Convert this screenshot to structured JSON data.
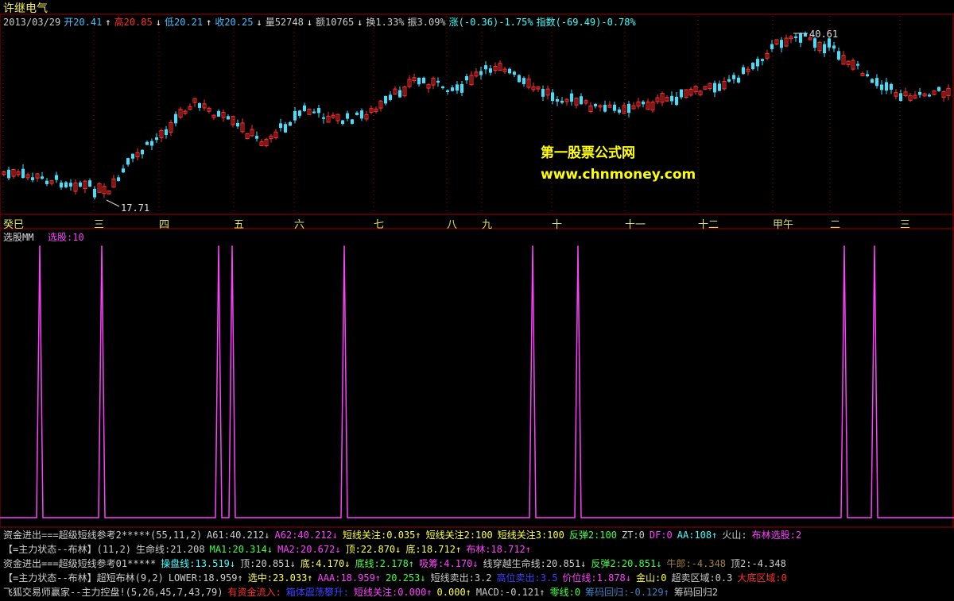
{
  "header": {
    "stock_name": "许继电气",
    "quote": [
      {
        "text": "2013/03/29",
        "color": "#cccccc"
      },
      {
        "text": "开20.41",
        "color": "#40c0ff"
      },
      {
        "text": "↑",
        "color": "#ffffff"
      },
      {
        "text": "高20.85",
        "color": "#ff3030"
      },
      {
        "text": "↓",
        "color": "#ffffff"
      },
      {
        "text": "低20.21",
        "color": "#40c0ff"
      },
      {
        "text": "↑",
        "color": "#ffffff"
      },
      {
        "text": "收20.25",
        "color": "#40c0ff"
      },
      {
        "text": "↓",
        "color": "#ffffff"
      },
      {
        "text": "量52748",
        "color": "#cccccc"
      },
      {
        "text": "↓",
        "color": "#ffffff"
      },
      {
        "text": "额10765",
        "color": "#cccccc"
      },
      {
        "text": "↓",
        "color": "#ffffff"
      },
      {
        "text": "换1.33%",
        "color": "#cccccc"
      },
      {
        "text": "振3.09%",
        "color": "#cccccc"
      },
      {
        "text": "涨(-0.36)-1.75%",
        "color": "#40ffff"
      },
      {
        "text": "指数(-69.49)-0.78%",
        "color": "#40ffff"
      }
    ]
  },
  "price_chart": {
    "high_label": "40.61",
    "low_label": "17.71",
    "watermark_title": "第一股票公式网",
    "watermark_url": "www.chnmoney.com",
    "months": [
      "癸巳",
      "三",
      "四",
      "五",
      "六",
      "七",
      "八",
      "九",
      "十",
      "十一",
      "十二",
      "甲午",
      "二",
      "三"
    ],
    "colors": {
      "up": "#ff3030",
      "down": "#40e0ff",
      "grid": "#a00000",
      "month": "#e0e060"
    }
  },
  "indicator": {
    "name": "选股MM",
    "value_label": "选股:10",
    "line_color": "#ff40ff"
  },
  "chart_data": {
    "type": "line",
    "title": "",
    "series": [
      {
        "name": "选股",
        "x": [
          50,
          128,
          275,
          292,
          433,
          670,
          727,
          1062,
          1100
        ],
        "values": [
          10,
          10,
          10,
          10,
          10,
          10,
          10,
          10,
          10
        ]
      }
    ],
    "ylim": [
      0,
      10
    ],
    "xlabel": "",
    "ylabel": ""
  },
  "bottom_lines": [
    [
      {
        "text": "资金进出===超级短线参考2*****(55,11,2)",
        "color": "#cccccc"
      },
      {
        "text": "A61:40.212↓",
        "color": "#cccccc"
      },
      {
        "text": "A62:40.212↓",
        "color": "#ff40ff"
      },
      {
        "text": "短线关注:0.035↑",
        "color": "#ffff40"
      },
      {
        "text": "短线关注2:100",
        "color": "#ffff40"
      },
      {
        "text": "短线关注3:100",
        "color": "#ffff40"
      },
      {
        "text": "反弹2:100",
        "color": "#40ff40"
      },
      {
        "text": "ZT:0",
        "color": "#cccccc"
      },
      {
        "text": "DF:0",
        "color": "#ff40ff"
      },
      {
        "text": "AA:108↑",
        "color": "#40ffff"
      },
      {
        "text": "火山:",
        "color": "#cccccc"
      },
      {
        "text": "布林选股:2",
        "color": "#ff40ff"
      }
    ],
    [
      {
        "text": "【=主力状态--布林】(11,2)",
        "color": "#cccccc"
      },
      {
        "text": "生命线:21.208",
        "color": "#cccccc"
      },
      {
        "text": "MA1:20.314↓",
        "color": "#40ff40"
      },
      {
        "text": "MA2:20.672↓",
        "color": "#ff40ff"
      },
      {
        "text": "顶:22.870↓",
        "color": "#ffff40"
      },
      {
        "text": "底:18.712↑",
        "color": "#ffff40"
      },
      {
        "text": "布林:18.712↑",
        "color": "#ff40ff"
      }
    ],
    [
      {
        "text": "资金进出===超级短线参考01*****",
        "color": "#cccccc"
      },
      {
        "text": "操盘线:13.519↓",
        "color": "#40ffff"
      },
      {
        "text": "顶:20.851↓",
        "color": "#cccccc"
      },
      {
        "text": "底:4.170↓",
        "color": "#ffff40"
      },
      {
        "text": "底线:2.178↑",
        "color": "#40ff40"
      },
      {
        "text": "吸筹:4.170↓",
        "color": "#ff40ff"
      },
      {
        "text": "线穿越生命线:20.851↓",
        "color": "#cccccc"
      },
      {
        "text": "反弹2:20.851↓",
        "color": "#40ff40"
      },
      {
        "text": "牛郎:-4.348",
        "color": "#a08040"
      },
      {
        "text": "顶2:-4.348",
        "color": "#cccccc"
      }
    ],
    [
      {
        "text": "【=主力状态--布林】超短布林(9,2)",
        "color": "#cccccc"
      },
      {
        "text": "LOWER:18.959↑",
        "color": "#cccccc"
      },
      {
        "text": "选中:23.033↑",
        "color": "#ffff40"
      },
      {
        "text": "AAA:18.959↑",
        "color": "#ff40ff"
      },
      {
        "text": "20.253↓",
        "color": "#40ff40"
      },
      {
        "text": "短线卖出:3.2",
        "color": "#cccccc"
      },
      {
        "text": "高位卖出:3.5",
        "color": "#4040ff"
      },
      {
        "text": "价位线:1.878↓",
        "color": "#ff40ff"
      },
      {
        "text": "金山:0",
        "color": "#ffff40"
      },
      {
        "text": "超卖区域:0.3",
        "color": "#cccccc"
      },
      {
        "text": "大底区域:0",
        "color": "#ff3030"
      }
    ],
    [
      {
        "text": "飞狐交易师赢家--主力控盘!(5,26,45,7,43,79)",
        "color": "#cccccc"
      },
      {
        "text": "有资金流入:",
        "color": "#ff3030"
      },
      {
        "text": "箱体震荡攀升:",
        "color": "#4040ff"
      },
      {
        "text": "短线关注:0.000↑",
        "color": "#ff40ff"
      },
      {
        "text": "0.000↑",
        "color": "#ffff40"
      },
      {
        "text": "MACD:-0.121↑",
        "color": "#cccccc"
      },
      {
        "text": "零线:0",
        "color": "#40ff40"
      },
      {
        "text": "筹码回归:-0.129↑",
        "color": "#4080c0"
      },
      {
        "text": "筹码回归2",
        "color": "#cccccc"
      }
    ]
  ]
}
